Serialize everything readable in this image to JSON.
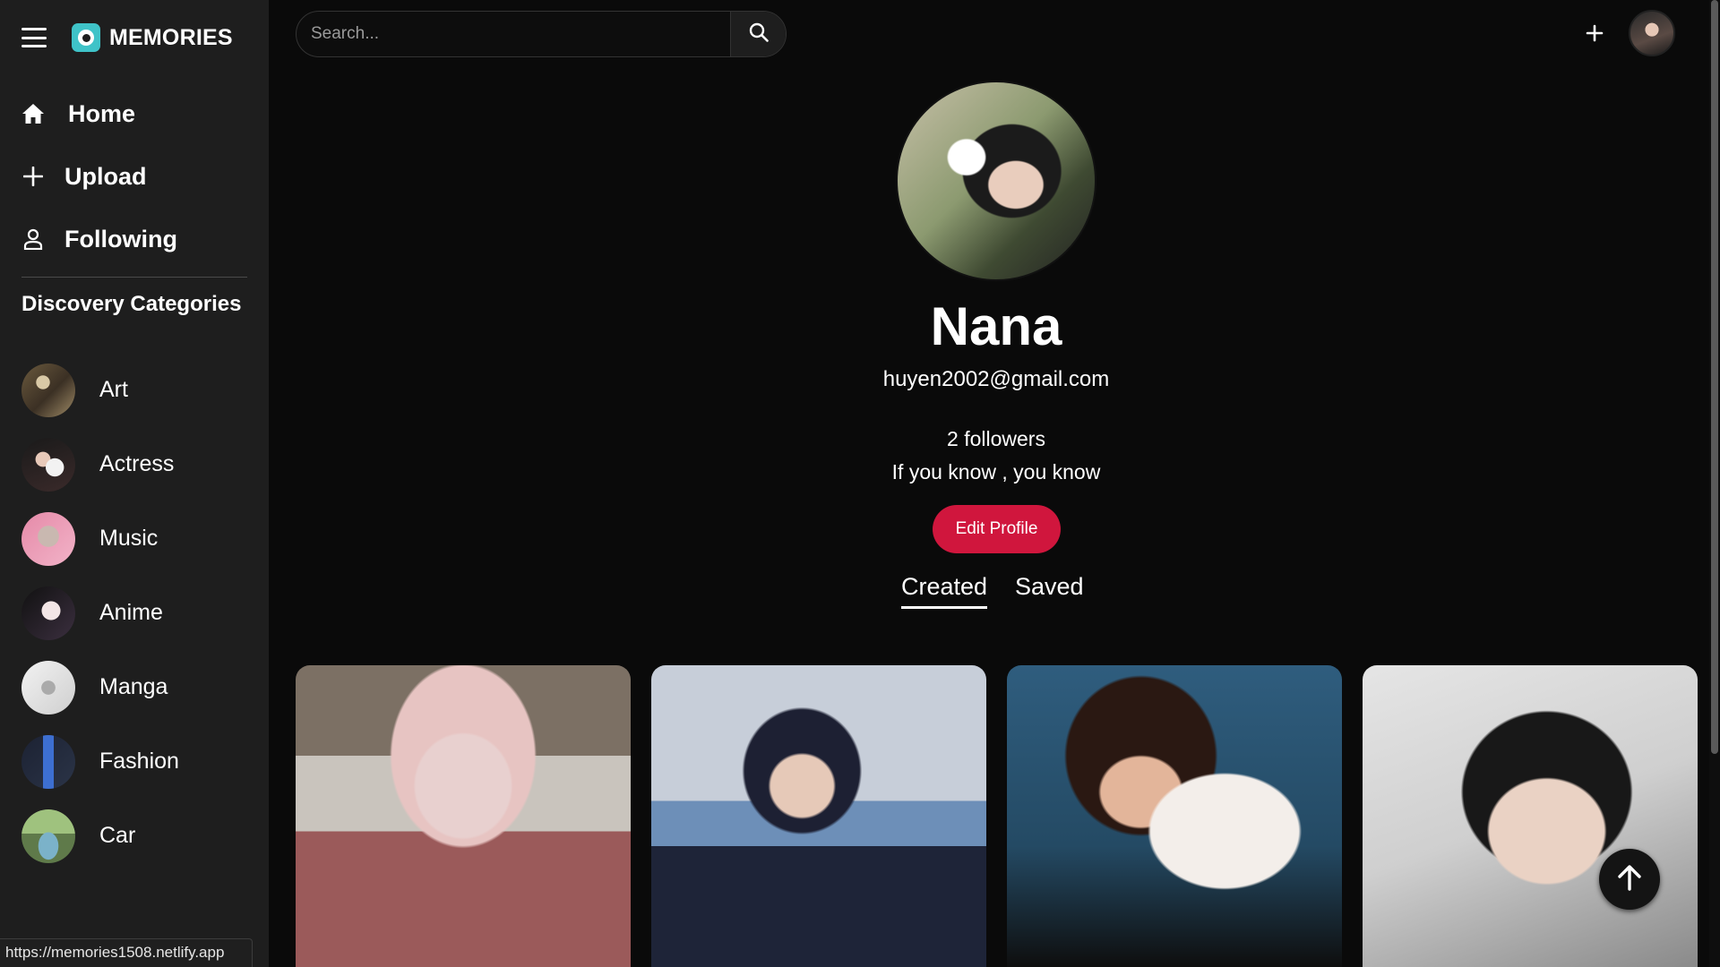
{
  "brand": {
    "name": "MEMORIES"
  },
  "nav": {
    "home": "Home",
    "upload": "Upload",
    "following": "Following"
  },
  "categories": {
    "title": "Discovery Categories",
    "items": [
      {
        "label": "Art"
      },
      {
        "label": "Actress"
      },
      {
        "label": "Music"
      },
      {
        "label": "Anime"
      },
      {
        "label": "Manga"
      },
      {
        "label": "Fashion"
      },
      {
        "label": "Car"
      }
    ]
  },
  "search": {
    "placeholder": "Search..."
  },
  "profile": {
    "name": "Nana",
    "email": "huyen2002@gmail.com",
    "followers": "2 followers",
    "bio": "If you know , you know",
    "edit_label": "Edit Profile"
  },
  "tabs": {
    "created": "Created",
    "saved": "Saved",
    "active": "Created"
  },
  "status_url": "https://memories1508.netlify.app",
  "colors": {
    "background": "#0a0a0a",
    "sidebar": "#1e1e1e",
    "accent": "#d0163d",
    "logo": "#3fc3c8"
  },
  "icons": [
    "menu-icon",
    "logo-icon",
    "home-icon",
    "plus-icon",
    "user-icon",
    "search-icon",
    "arrow-up-icon"
  ]
}
